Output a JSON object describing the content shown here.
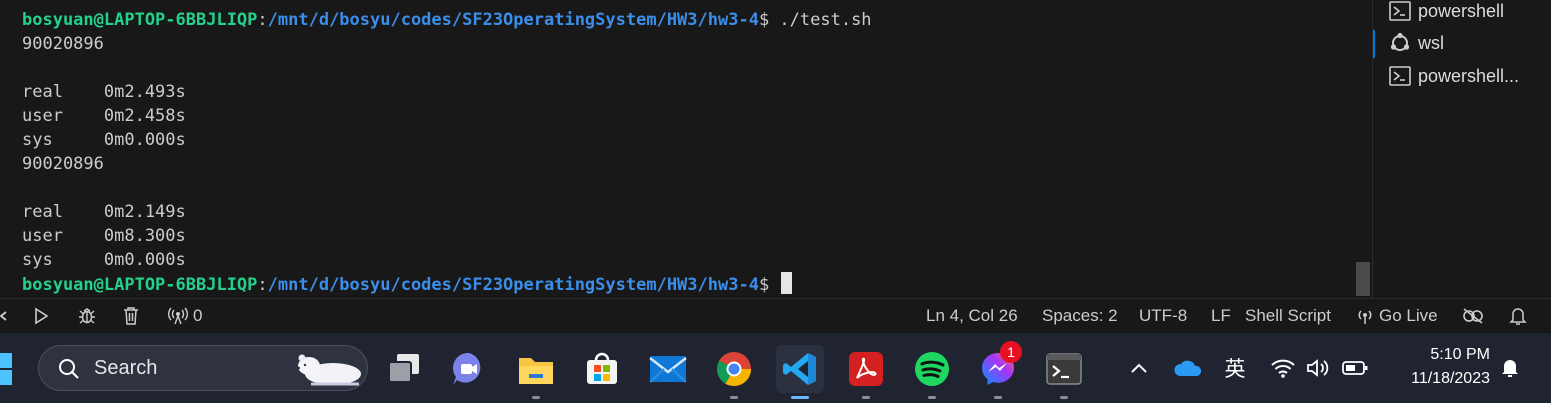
{
  "terminal": {
    "lines": [
      {
        "user": "bosyuan@LAPTOP-6BBJLIQP",
        "sep": ":",
        "path": "/mnt/d/bosyu/codes/SF23OperatingSystem/HW3/hw3-4",
        "prompt": "$ ",
        "command": "./test.sh"
      },
      {
        "text": "90020896"
      },
      {
        "text": ""
      },
      {
        "text": "real    0m2.493s"
      },
      {
        "text": "user    0m2.458s"
      },
      {
        "text": "sys     0m0.000s"
      },
      {
        "text": "90020896"
      },
      {
        "text": ""
      },
      {
        "text": "real    0m2.149s"
      },
      {
        "text": "user    0m8.300s"
      },
      {
        "text": "sys     0m0.000s"
      },
      {
        "user": "bosyuan@LAPTOP-6BBJLIQP",
        "sep": ":",
        "path": "/mnt/d/bosyu/codes/SF23OperatingSystem/HW3/hw3-4",
        "prompt": "$ ",
        "command": ""
      }
    ]
  },
  "sidebar": {
    "items": [
      {
        "label": "powershell",
        "icon": "powershell-icon"
      },
      {
        "label": "wsl",
        "icon": "ubuntu-icon",
        "active": true
      },
      {
        "label": "powershell...",
        "icon": "powershell-icon"
      }
    ]
  },
  "statusbar": {
    "ports": "0",
    "position": "Ln 4, Col 26",
    "spaces": "Spaces: 2",
    "encoding": "UTF-8",
    "eol": "LF",
    "language": "Shell Script",
    "golive": "Go Live"
  },
  "taskbar": {
    "search_label": "Search",
    "apps": [
      "task-view",
      "teams-chat",
      "file-explorer",
      "microsoft-store",
      "mail",
      "chrome",
      "vscode",
      "acrobat",
      "spotify",
      "messenger",
      "terminal"
    ],
    "active_app": "vscode",
    "messenger_badge": "1",
    "ime": "英",
    "time": "5:10 PM",
    "date": "11/18/2023"
  },
  "colors": {
    "background": "#181818",
    "prompt_user": "#23d18b",
    "prompt_path": "#3b8eea",
    "accent": "#0078d4",
    "taskbar": "#202431"
  }
}
